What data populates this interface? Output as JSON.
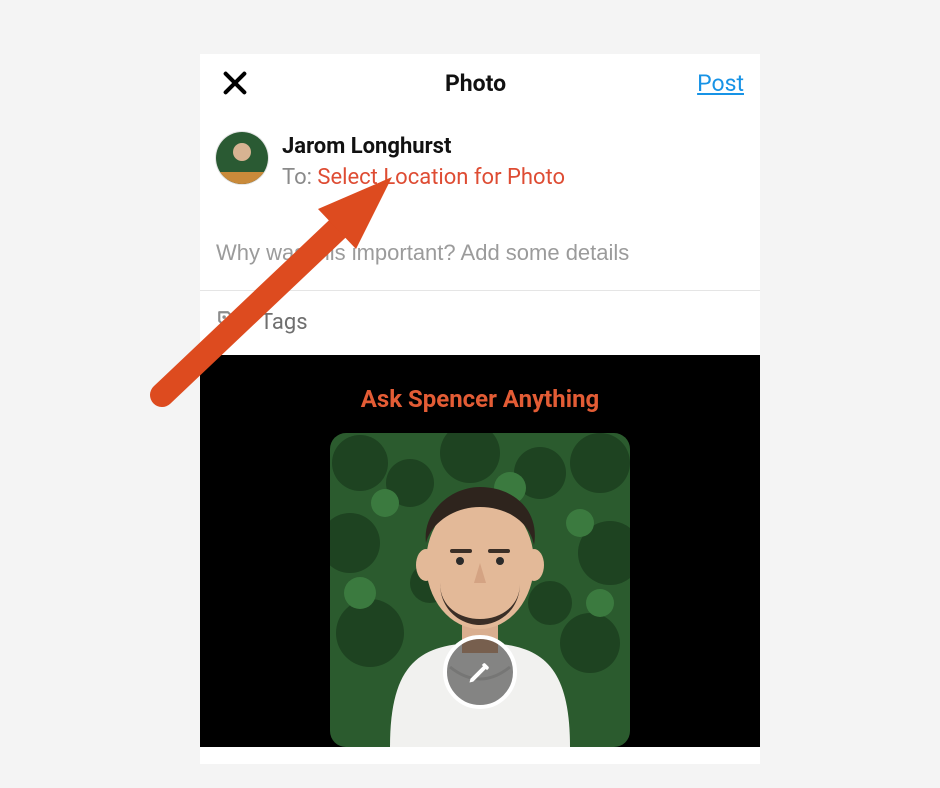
{
  "header": {
    "title": "Photo",
    "post_label": "Post"
  },
  "user": {
    "name": "Jarom Longhurst",
    "to_prefix": "To: ",
    "select_location": "Select Location for Photo"
  },
  "caption": {
    "placeholder": "Why was this important? Add some details"
  },
  "tags": {
    "label": "Tags"
  },
  "preview": {
    "headline": "Ask Spencer Anything"
  },
  "colors": {
    "accent_orange": "#de4c33",
    "link_blue": "#1793e6"
  }
}
